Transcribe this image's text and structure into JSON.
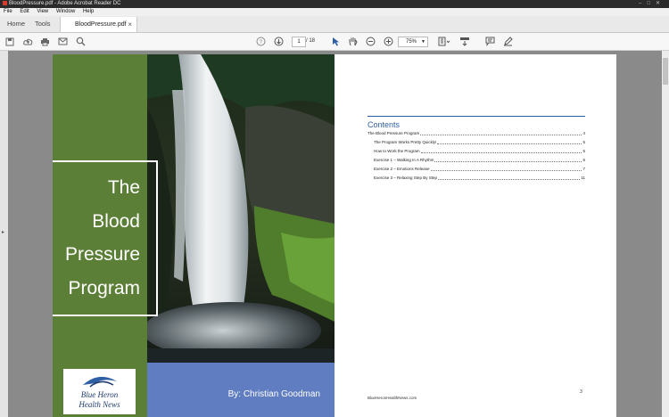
{
  "window": {
    "title": "BloodPressure.pdf - Adobe Acrobat Reader DC"
  },
  "menu": [
    "File",
    "Edit",
    "View",
    "Window",
    "Help"
  ],
  "tabs": {
    "home": "Home",
    "tools": "Tools",
    "document": "BloodPressure.pdf",
    "close": "×"
  },
  "toolbar": {
    "current_page": "1",
    "total_pages": "/ 18",
    "zoom": "75%"
  },
  "cover": {
    "title_lines": [
      "The",
      "Blood",
      "Pressure",
      "Program"
    ],
    "author": "By: Christian Goodman",
    "logo_line1": "Blue Heron",
    "logo_line2": "Health News",
    "colors": {
      "green": "#5b7f36",
      "blue": "#5f7dc0"
    }
  },
  "contents": {
    "title": "Contents",
    "entries": [
      {
        "text": "The Blood Pressure Program",
        "page": "4"
      },
      {
        "text": "The Program Works Pretty Quickly!",
        "page": "5"
      },
      {
        "text": "How to Work the Program",
        "page": "5"
      },
      {
        "text": "Exercise 1 – Walking In A Rhythm",
        "page": "6"
      },
      {
        "text": "Exercise 2 – Emotions Release",
        "page": "7"
      },
      {
        "text": "Exercise 3 – Relaxing Step By Step",
        "page": "11"
      }
    ],
    "footer_site": "BlueHeronHealthNews.com",
    "page_number": "3"
  }
}
